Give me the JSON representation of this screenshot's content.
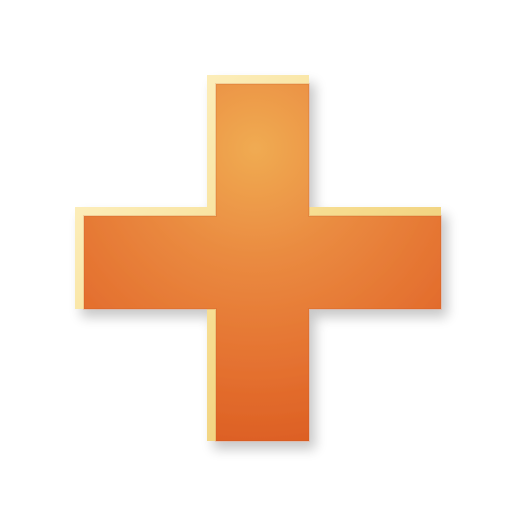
{
  "icon": {
    "name": "add-plus-icon",
    "colors": {
      "highlight_top": "#f0a94f",
      "orange_mid": "#e8773a",
      "orange_deep": "#df5c22",
      "rim_light": "#fff2c2",
      "rim_gold": "#f1d27a",
      "shadow": "#3a2a1a"
    }
  }
}
